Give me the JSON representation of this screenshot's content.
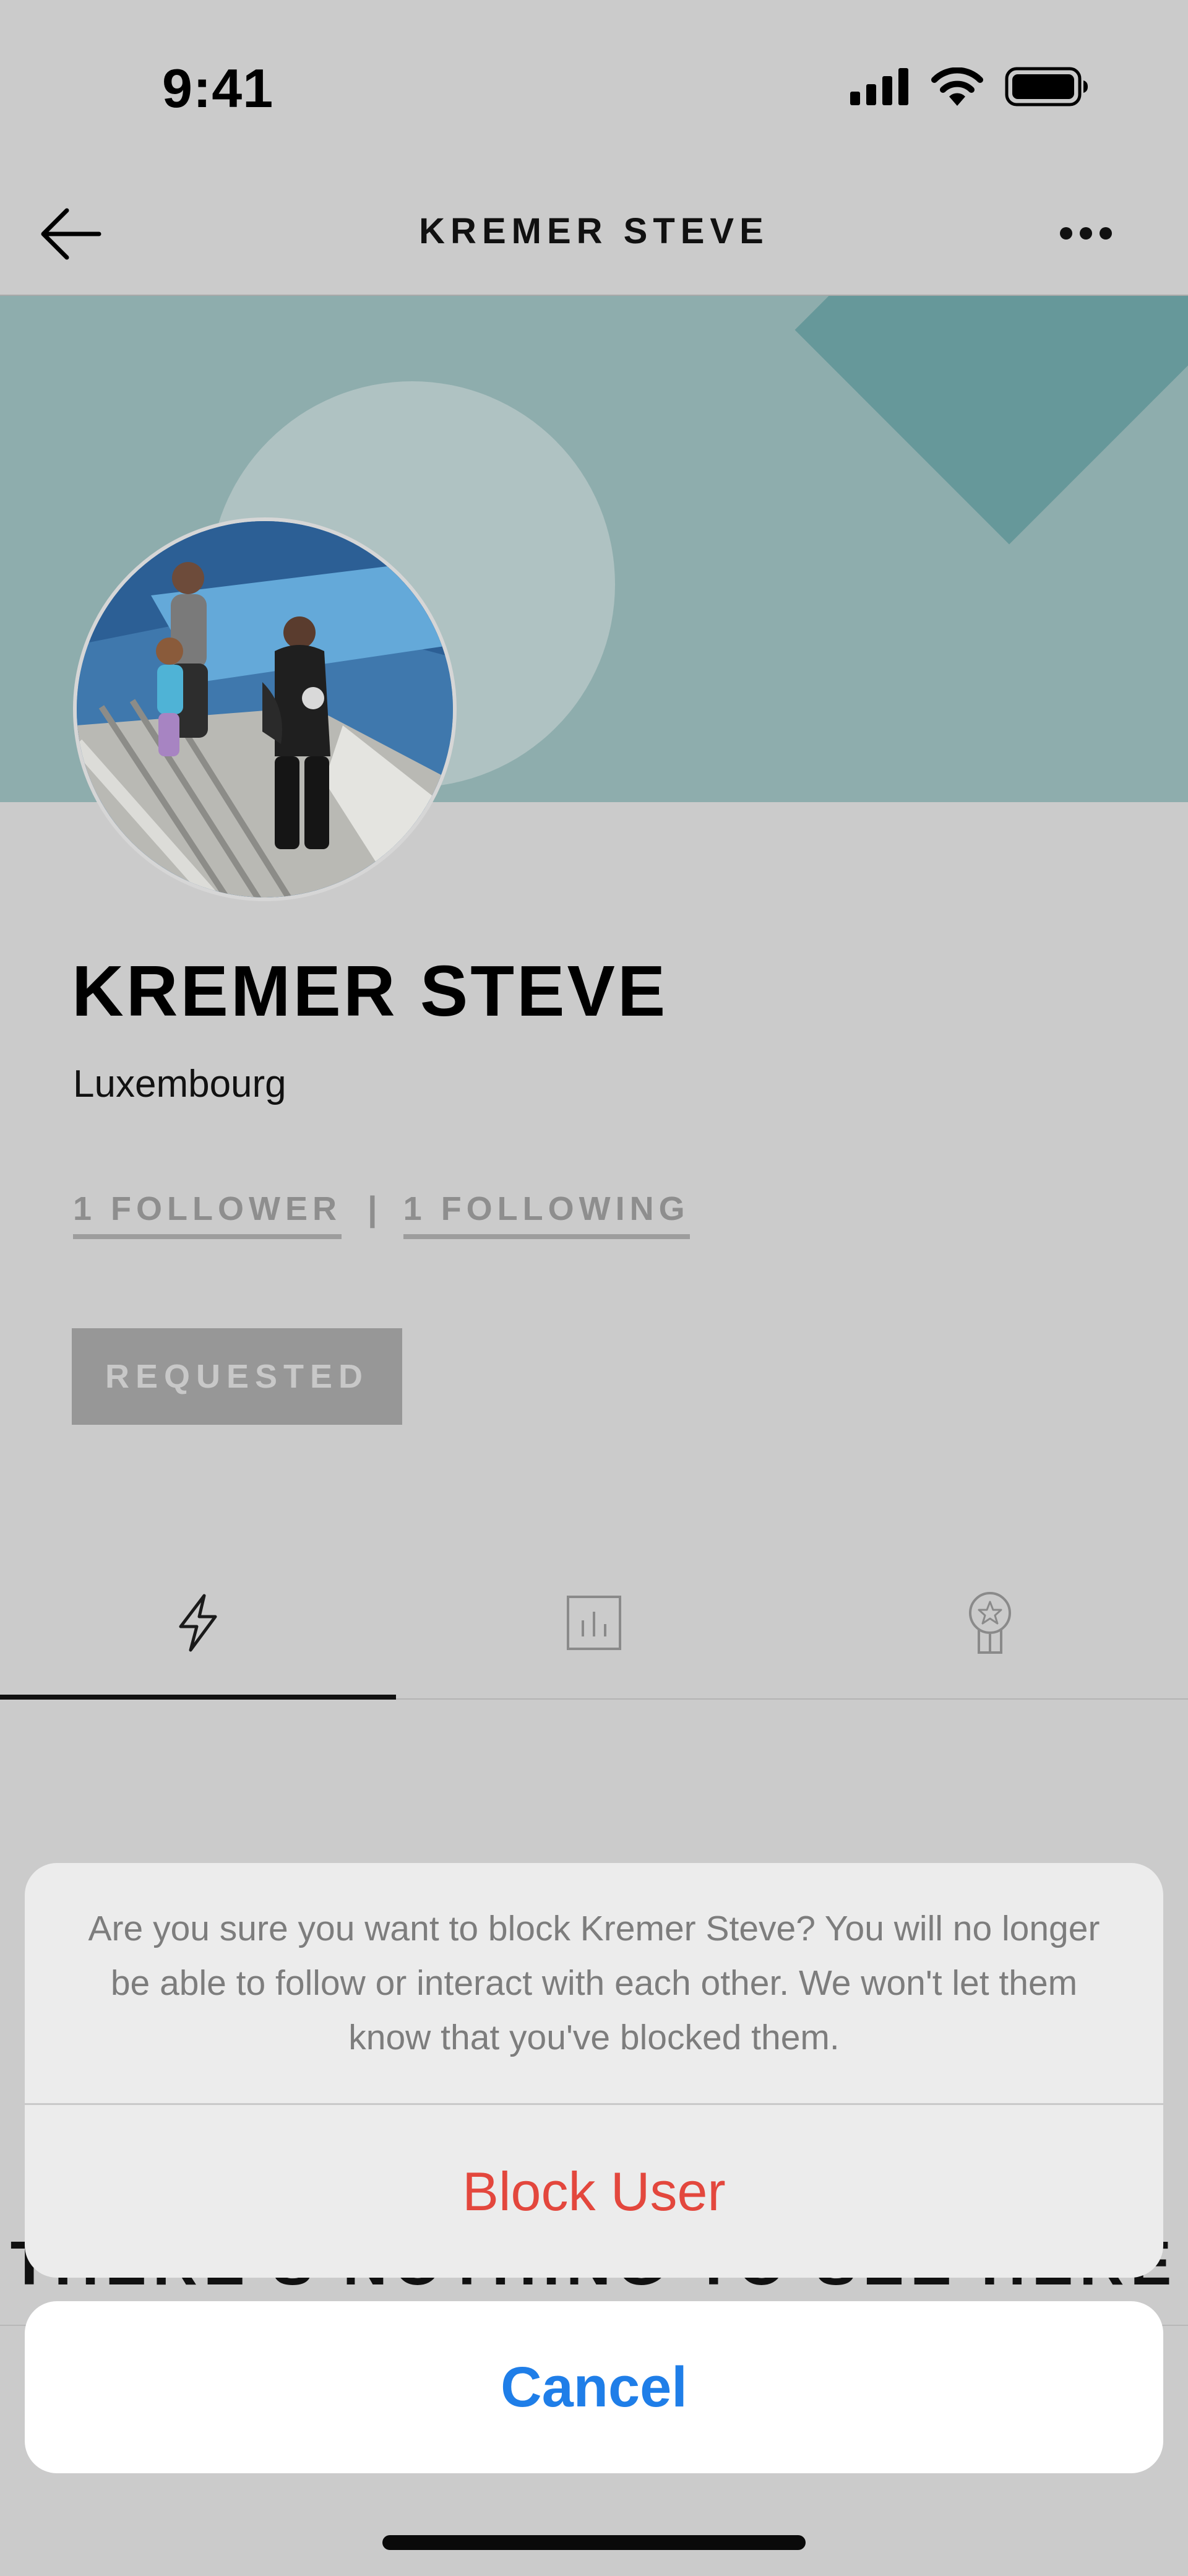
{
  "status_bar": {
    "time": "9:41",
    "icons": [
      "cellular-signal-icon",
      "wifi-icon",
      "battery-icon"
    ]
  },
  "nav": {
    "title": "KREMER STEVE",
    "back_icon": "arrow-left-icon",
    "more_icon": "ellipsis-icon"
  },
  "profile": {
    "name": "KREMER STEVE",
    "location": "Luxembourg",
    "followers_label": "1 FOLLOWER",
    "separator": "|",
    "following_label": "1 FOLLOWING",
    "request_button_label": "REQUESTED"
  },
  "tabs": [
    {
      "icon": "lightning-bolt-icon",
      "active": true
    },
    {
      "icon": "bar-chart-icon",
      "active": false
    },
    {
      "icon": "award-badge-icon",
      "active": false
    }
  ],
  "empty_state": {
    "title": "THERE'S NOTHING TO SEE HERE"
  },
  "action_sheet": {
    "message": "Are you sure you want to block Kremer Steve? You will no longer be able to follow or interact with each other. We won't let them know that you've blocked them.",
    "block_label": "Block User",
    "cancel_label": "Cancel"
  },
  "colors": {
    "banner": "#8eadad",
    "banner_circle": "#afc2c2",
    "banner_diamond": "#66989a",
    "destructive": "#e3473d",
    "cancel": "#1f7ee8",
    "dimmed_background": "#cbcbcb"
  }
}
